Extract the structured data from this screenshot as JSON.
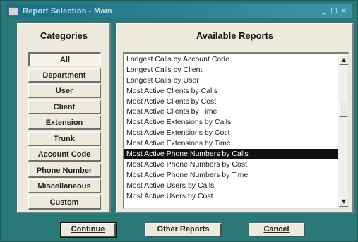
{
  "window": {
    "title": "Report Selection - Main",
    "controls": [
      "_",
      "□",
      "×"
    ]
  },
  "categories": {
    "heading": "Categories",
    "items": [
      {
        "label": "All",
        "selected": true
      },
      {
        "label": "Department",
        "selected": false
      },
      {
        "label": "User",
        "selected": false
      },
      {
        "label": "Client",
        "selected": false
      },
      {
        "label": "Extension",
        "selected": false
      },
      {
        "label": "Trunk",
        "selected": false
      },
      {
        "label": "Account Code",
        "selected": false
      },
      {
        "label": "Phone Number",
        "selected": false
      },
      {
        "label": "Miscellaneous",
        "selected": false
      },
      {
        "label": "Custom",
        "selected": false
      }
    ]
  },
  "reports": {
    "heading": "Available Reports",
    "items": [
      "Longest Calls by Account Code",
      "Longest Calls by Client",
      "Longest Calls by User",
      "Most Active Clients by Calls",
      "Most Active Clients by Cost",
      "Most Active Clients by Time",
      "Most Active Extensions by Calls",
      "Most Active Extensions by Cost",
      "Most Active Extensions by Time",
      "Most Active Phone Numbers by Calls",
      "Most Active Phone Numbers by Cost",
      "Most Active Phone Numbers by Time",
      "Most Active Users by Calls",
      "Most Active Users by Cost"
    ],
    "selected_index": 9
  },
  "buttons": {
    "continue": "Continue",
    "other_reports": "Other Reports",
    "cancel": "Cancel"
  },
  "colors": {
    "window_bg": "#2a7878",
    "panel_bg": "#ece9dd",
    "selection_bg": "#101010",
    "page_bg": "#f4d9a6"
  }
}
